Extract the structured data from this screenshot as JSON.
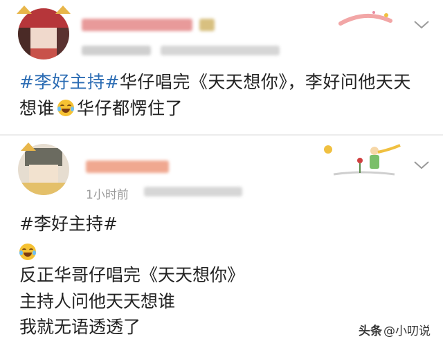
{
  "post1": {
    "text_hashtag": "#李好主持#",
    "text_line1_rest": "华仔唱完《天天想你》，李好问他天天",
    "text_line2_start": "想谁",
    "text_line2_end": "华仔都愣住了",
    "emoji_icon": "laugh-cry-icon"
  },
  "post2": {
    "time": "1小时前",
    "hashtag": "#李好主持#",
    "lines": [
      "反正华哥仔唱完《天天想你》",
      "主持人问他天天想谁",
      "我就无语透透了"
    ],
    "emoji_icon": "laugh-cry-icon"
  },
  "watermark": {
    "source": "头条",
    "author": "@小叨说"
  },
  "colors": {
    "hashtag": "#2a6bb3",
    "text": "#222222",
    "meta": "#9a9a9a"
  }
}
